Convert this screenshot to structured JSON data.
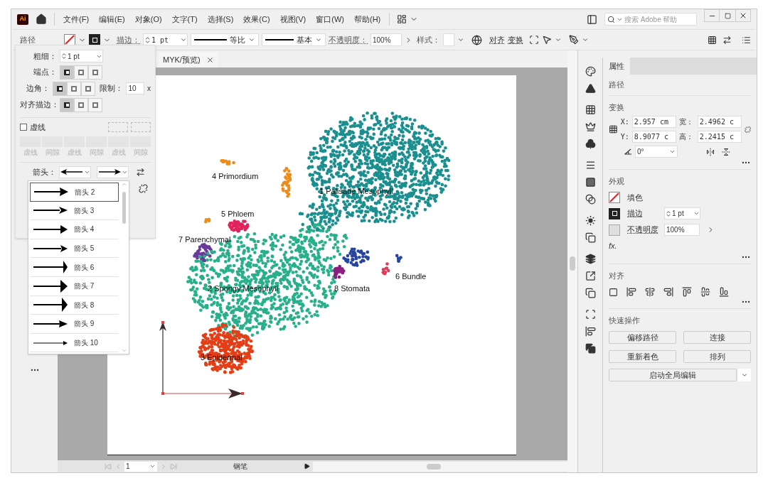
{
  "menu_bar": {
    "app_logo": "Ai",
    "menus": [
      "文件(F)",
      "编辑(E)",
      "对象(O)",
      "文字(T)",
      "选择(S)",
      "效果(C)",
      "视图(V)",
      "窗口(W)",
      "帮助(H)"
    ],
    "search": {
      "placeholder": "搜索 Adobe 帮助"
    }
  },
  "control_bar": {
    "object_type": "路径",
    "stroke_label": "描边：",
    "stroke_weight": "1 pt",
    "profile": "等比",
    "brush": "基本",
    "opacity_label": "不透明度：",
    "opacity": "100%",
    "style_label": "样式：",
    "align": "对齐",
    "transform": "变换"
  },
  "stroke_panel": {
    "weight_label": "粗细：",
    "weight": "1 pt",
    "cap_label": "端点：",
    "caps": [
      {
        "selected": true
      },
      {
        "selected": false
      },
      {
        "selected": false
      }
    ],
    "corner_label": "边角：",
    "corners": [
      {
        "selected": true
      },
      {
        "selected": false
      },
      {
        "selected": false
      }
    ],
    "limit_label": "限制：",
    "limit": "10",
    "limit_unit": "x",
    "align_label": "对齐描边：",
    "aligns": [
      {
        "selected": true
      },
      {
        "selected": false
      },
      {
        "selected": false
      }
    ],
    "dashed": {
      "label": "虚线",
      "checked": false
    },
    "dash_fields": [
      "虚线",
      "间隙",
      "虚线",
      "间隙",
      "虚线",
      "间隙"
    ],
    "arrow_label": "箭头：",
    "arrowheads": [
      {
        "label": "箭头 2",
        "selected": true
      },
      {
        "label": "箭头 3",
        "selected": false
      },
      {
        "label": "箭头 4",
        "selected": false
      },
      {
        "label": "箭头 5",
        "selected": false
      },
      {
        "label": "箭头 6",
        "selected": false
      },
      {
        "label": "箭头 7",
        "selected": false
      },
      {
        "label": "箭头 8",
        "selected": false
      },
      {
        "label": "箭头 9",
        "selected": false
      },
      {
        "label": "箭头 10",
        "selected": false
      }
    ]
  },
  "document_tab": {
    "title": "MYK/预览)"
  },
  "artwork": {
    "clusters": [
      {
        "label": "4 Primordium",
        "color": "#ee8c1a"
      },
      {
        "label": "1 Palisade Mesophyll",
        "color": "#1b8f8f"
      },
      {
        "label": "5 Phloem",
        "color": "#e0245e"
      },
      {
        "label": "7 Parenchymal",
        "color": "#6a3a9a"
      },
      {
        "label": "6 Bundle",
        "color": "#e23c5c"
      },
      {
        "label": "2 Spongy Mesophyll",
        "color": "#27b08a"
      },
      {
        "label": "8 Stomata",
        "color": "#8b1e7e"
      },
      {
        "label": "3 Epidermal",
        "color": "#e43e16"
      },
      {
        "color": "#25459e"
      }
    ]
  },
  "status_bar": {
    "page": "1",
    "tool": "钢笔"
  },
  "properties_panel": {
    "tab": "属性",
    "object_type": "路径",
    "transform": {
      "title": "变换",
      "x_label": "X:",
      "x": "2.957 cm",
      "y_label": "Y:",
      "y": "8.9077 c",
      "w_label": "宽：",
      "w": "2.4962 c",
      "h_label": "高：",
      "h": "2.2415 c",
      "angle": "0°"
    },
    "appearance": {
      "title": "外观",
      "fill": "填色",
      "stroke": "描边",
      "stroke_weight": "1 pt",
      "opacity": "不透明度",
      "opacity_value": "100%",
      "fx": "fx."
    },
    "align_title": "对齐",
    "quick_actions": {
      "title": "快速操作",
      "buttons": [
        "偏移路径",
        "连接",
        "重新着色",
        "排列"
      ],
      "global_edit": "启动全局编辑"
    }
  }
}
